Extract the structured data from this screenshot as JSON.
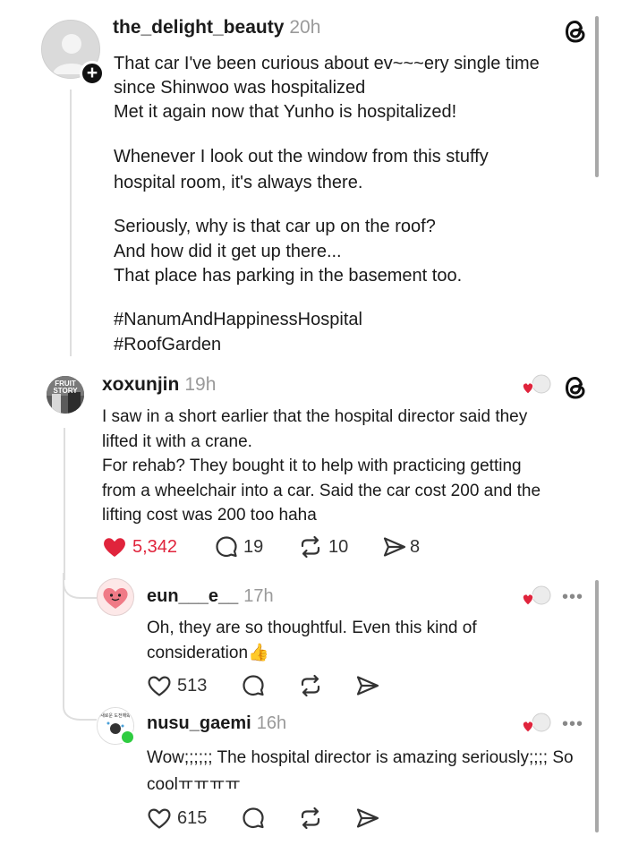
{
  "post": {
    "username": "the_delight_beauty",
    "time": "20h",
    "lines": [
      "That car I've been curious about ev~~~ery single time",
      "since Shinwoo was hospitalized",
      "Met it again now that Yunho is hospitalized!",
      "",
      "Whenever I look out the window from this stuffy",
      "hospital room, it's always there.",
      "",
      "Seriously, why is that car up on the roof?",
      "And how did it get up there...",
      "That place has parking in the basement too.",
      "",
      "#NanumAndHappinessHospital",
      "#RoofGarden"
    ],
    "plus_label": "+"
  },
  "reply1": {
    "username": "xoxunjin",
    "time": "19h",
    "avatar_text": "FRUIT STORY",
    "lines": [
      "I saw in a short earlier that the hospital director said they",
      "lifted it with a crane.",
      "For rehab? They bought it to help with practicing getting",
      "from a wheelchair into a car. Said the car cost 200 and the",
      "lifting cost was 200 too haha"
    ],
    "likes": "5,342",
    "replies": "19",
    "reposts": "10",
    "shares": "8"
  },
  "reply2": {
    "username": "eun___e__",
    "time": "17h",
    "lines": [
      "Oh, they are so thoughtful. Even this kind of",
      "consideration"
    ],
    "emoji": "👍",
    "likes": "513",
    "more": "•••"
  },
  "reply3": {
    "username": "nusu_gaemi",
    "time": "16h",
    "avatar_text": "새로운 도전해봐",
    "lines": [
      "Wow;;;;;; The hospital director is amazing seriously;;;; So",
      "coolㅠㅠㅠㅠ"
    ],
    "likes": "615",
    "more": "•••"
  },
  "colors": {
    "like_red": "#e0243c",
    "online_green": "#2ecc40",
    "time_grey": "#9a9a9a"
  },
  "icons": [
    "threads-logo-icon",
    "heart-icon",
    "comment-icon",
    "repost-icon",
    "share-icon",
    "more-icon",
    "plus-icon"
  ]
}
